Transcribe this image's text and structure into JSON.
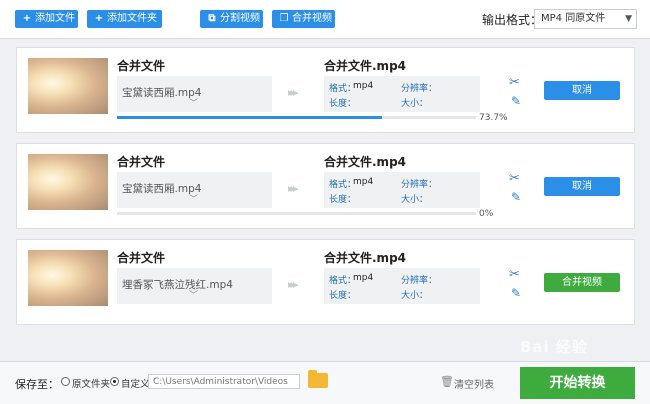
{
  "toolbar": {
    "add_file": "添加文件",
    "add_folder": "添加文件夹",
    "split_video": "分割视频",
    "merge_video": "合并视频",
    "output_format_label": "输出格式：",
    "output_format_value": "MP4  同原文件"
  },
  "items": [
    {
      "src_title": "合并文件",
      "src_name": "宝黛读西厢.mp4",
      "out_title": "合并文件.mp4",
      "format_label": "格式：",
      "format_value": "mp4",
      "resolution_label": "分辨率：",
      "length_label": "长度：",
      "size_label": "大小：",
      "action_label": "取消",
      "progress": 0.737,
      "progress_text": "73.7%"
    },
    {
      "src_title": "合并文件",
      "src_name": "宝黛读西厢.mp4",
      "out_title": "合并文件.mp4",
      "format_label": "格式：",
      "format_value": "mp4",
      "resolution_label": "分辨率：",
      "length_label": "长度：",
      "size_label": "大小：",
      "action_label": "取消",
      "progress": 0.0,
      "progress_text": "0%"
    },
    {
      "src_title": "合并文件",
      "src_name": "埋香冢飞燕泣残红.mp4",
      "out_title": "合并文件.mp4",
      "format_label": "格式：",
      "format_value": "mp4",
      "resolution_label": "分辨率：",
      "length_label": "长度：",
      "size_label": "大小：",
      "action_label": "合并视频"
    }
  ],
  "bottom": {
    "save_to_label": "保存至：",
    "original_folder_label": "原文件夹",
    "custom_label": "自定义",
    "path_value": "C:\\Users\\Administrator\\Videos",
    "clear_list_label": "清空列表",
    "start_label": "开始转换"
  },
  "watermark": "Bai 经验",
  "colors": {
    "accent_blue": "#2b8fe8",
    "accent_green": "#3eab3e"
  },
  "icons": [
    "plus-icon",
    "folder-plus-icon",
    "split-icon",
    "merge-icon",
    "dropdown-arrow-icon",
    "scissors-icon",
    "edit-icon",
    "folder-icon",
    "trash-icon"
  ]
}
